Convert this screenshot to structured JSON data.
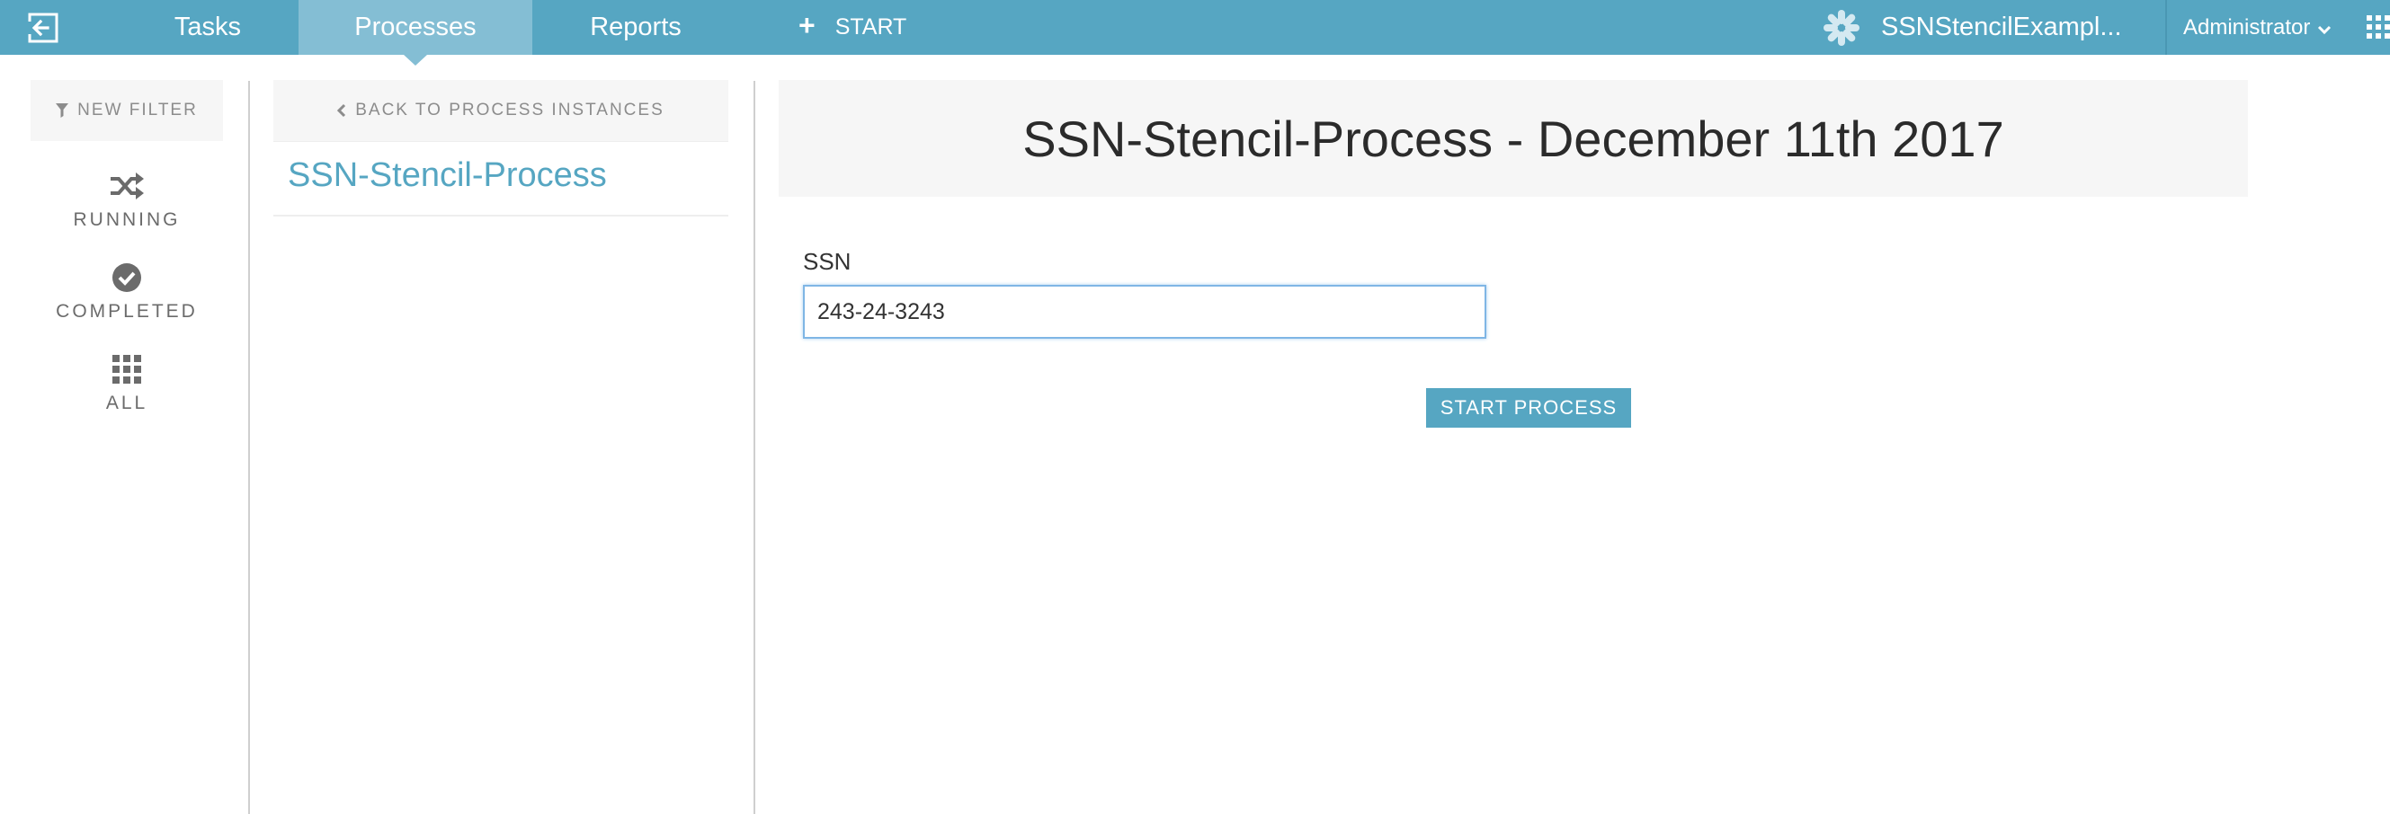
{
  "topbar": {
    "logo_icon": "exit-app-icon",
    "nav": {
      "tasks": "Tasks",
      "processes": "Processes",
      "reports": "Reports"
    },
    "active_nav": "Processes",
    "start_label": "START",
    "app_icon": "asterisk-flower-icon",
    "app_name": "SSNStencilExampl...",
    "user_name": "Administrator",
    "apps_icon": "apps-grid-icon",
    "color": "#56a6c2"
  },
  "filters": {
    "new_filter_label": "NEW FILTER",
    "items": [
      {
        "label": "RUNNING",
        "icon": "shuffle-icon"
      },
      {
        "label": "COMPLETED",
        "icon": "check-circle-icon"
      },
      {
        "label": "ALL",
        "icon": "grid-icon"
      }
    ]
  },
  "process_list": {
    "back_label": "BACK TO PROCESS INSTANCES",
    "selected_process": "SSN-Stencil-Process"
  },
  "main": {
    "title": "SSN-Stencil-Process - December 11th 2017",
    "field_label": "SSN",
    "field_value": "243-24-3243",
    "start_button_label": "START PROCESS"
  }
}
